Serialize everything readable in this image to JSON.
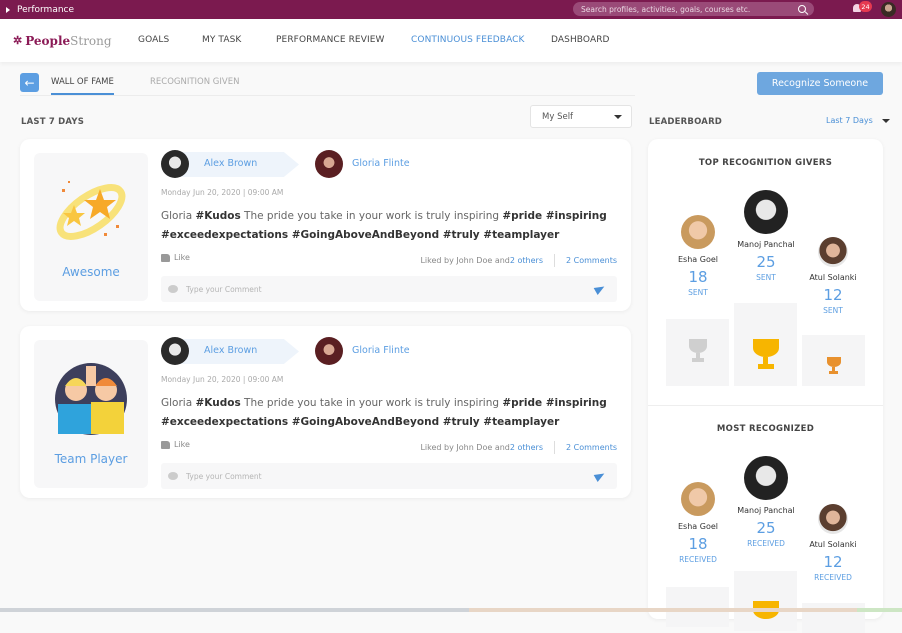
{
  "topbar": {
    "module": "Performance",
    "search_placeholder": "Search profiles, activities, goals, courses etc.",
    "notification_count": "24"
  },
  "navbar": {
    "brand_part1": "People",
    "brand_part2": "Strong",
    "items": [
      {
        "label": "GOALS",
        "active": false
      },
      {
        "label": "MY TASK",
        "active": false
      },
      {
        "label": "PERFORMANCE REVIEW",
        "active": false
      },
      {
        "label": "CONTINUOUS FEEDBACK",
        "active": true
      },
      {
        "label": "DASHBOARD",
        "active": false
      }
    ]
  },
  "tabs": {
    "active": "WALL OF FAME",
    "inactive": "RECOGNITION GIVEN"
  },
  "recognize_button": "Recognize Someone",
  "feed": {
    "period_label": "LAST 7 DAYS",
    "filter_value": "My Self",
    "posts": [
      {
        "badge": "Awesome",
        "sender": "Alex Brown",
        "recipient": "Gloria Flinte",
        "timestamp": "Monday Jun 20, 2020  |  09:00 AM",
        "msg_name": "Gloria ",
        "msg_tag1": "#Kudos",
        "msg_text": " The pride you take in your work is truly inspiring ",
        "msg_tags": "#pride #inspiring #exceedexpectations #GoingAboveAndBeyond #truly #teamplayer",
        "like_label": "Like",
        "liked_by": "Liked by John Doe and ",
        "others": "2 others",
        "comments": "2 Comments",
        "comment_placeholder": "Type your Comment"
      },
      {
        "badge": "Team Player",
        "sender": "Alex Brown",
        "recipient": "Gloria Flinte",
        "timestamp": "Monday Jun 20, 2020  |  09:00 AM",
        "msg_name": "Gloria ",
        "msg_tag1": "#Kudos",
        "msg_text": " The pride you take in your work is truly inspiring ",
        "msg_tags": "#pride #inspiring #exceedexpectations #GoingAboveAndBeyond #truly #teamplayer",
        "like_label": "Like",
        "liked_by": "Liked by John Doe and ",
        "others": "2 others",
        "comments": "2 Comments",
        "comment_placeholder": "Type your Comment"
      }
    ]
  },
  "leaderboard": {
    "label": "LEADERBOARD",
    "range": "Last 7 Days",
    "givers": {
      "title": "TOP RECOGNITION GIVERS",
      "first": {
        "name": "Manoj Panchal",
        "count": "25",
        "unit": "SENT"
      },
      "second": {
        "name": "Esha Goel",
        "count": "18",
        "unit": "SENT"
      },
      "third": {
        "name": "Atul Solanki",
        "count": "12",
        "unit": "SENT"
      }
    },
    "recognized": {
      "title": "MOST RECOGNIZED",
      "first": {
        "name": "Manoj Panchal",
        "count": "25",
        "unit": "RECEIVED"
      },
      "second": {
        "name": "Esha Goel",
        "count": "18",
        "unit": "RECEIVED"
      },
      "third": {
        "name": "Atul Solanki",
        "count": "12",
        "unit": "RECEIVED"
      }
    }
  },
  "colors": {
    "brand": "#7b1a4f",
    "accent": "#4a8fd6",
    "gold": "#f7b500",
    "silver": "#cfcfcf",
    "bronze": "#e8912e"
  }
}
